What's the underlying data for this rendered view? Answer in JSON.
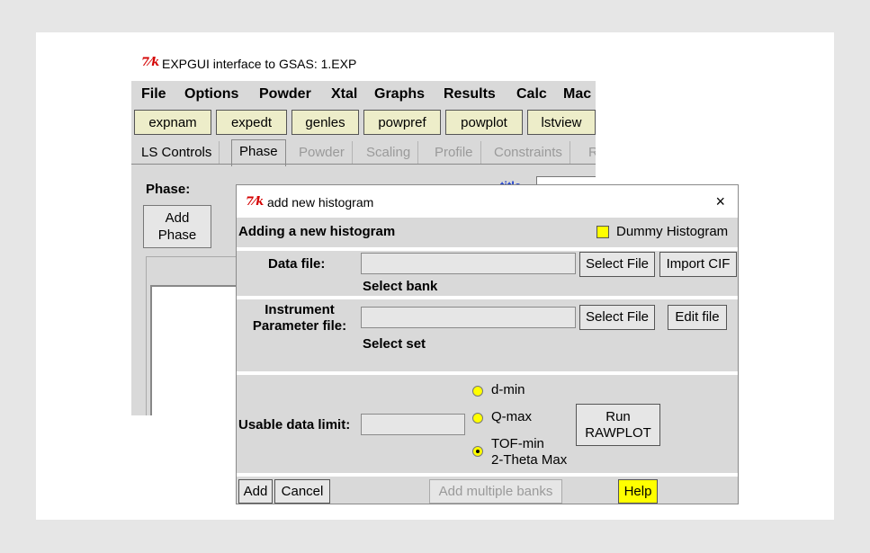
{
  "main_window": {
    "title": "EXPGUI interface to GSAS: 1.EXP",
    "menu": [
      "File",
      "Options",
      "Powder",
      "Xtal",
      "Graphs",
      "Results",
      "Calc",
      "Mac"
    ],
    "toolbar": [
      "expnam",
      "expedt",
      "genles",
      "powpref",
      "powplot",
      "lstview"
    ],
    "tabs": [
      "LS Controls",
      "Phase",
      "Powder",
      "Scaling",
      "Profile",
      "Constraints",
      "R"
    ],
    "active_tab": "Phase",
    "phase_label": "Phase:",
    "add_phase_line1": "Add",
    "add_phase_line2": "Phase",
    "title_glimpse": "title"
  },
  "dialog": {
    "title": "add new histogram",
    "close": "×",
    "heading": "Adding a new histogram",
    "dummy_label": "Dummy Histogram",
    "data_file_label": "Data file:",
    "data_file_value": "",
    "select_file": "Select File",
    "import_cif": "Import CIF",
    "select_bank": "Select bank",
    "instr_label_line1": "Instrument",
    "instr_label_line2": "Parameter file:",
    "instr_value": "",
    "select_file2": "Select File",
    "edit_file": "Edit file",
    "select_set": "Select set",
    "usable_label": "Usable data limit:",
    "usable_value": "",
    "radio_dmin": "d-min",
    "radio_qmax": "Q-max",
    "radio_tof_line1": "TOF-min",
    "radio_tof_line2": "2-Theta Max",
    "selected_radio": "TOF-min / 2-Theta Max",
    "run_line1": "Run",
    "run_line2": "RAWPLOT",
    "add": "Add",
    "cancel": "Cancel",
    "add_multiple": "Add multiple banks",
    "help": "Help"
  },
  "colors": {
    "toolbar_button": "#ededc9",
    "help_button": "#ffff00",
    "radio_fill": "#ffff00",
    "tk_logo": "#d40000"
  }
}
